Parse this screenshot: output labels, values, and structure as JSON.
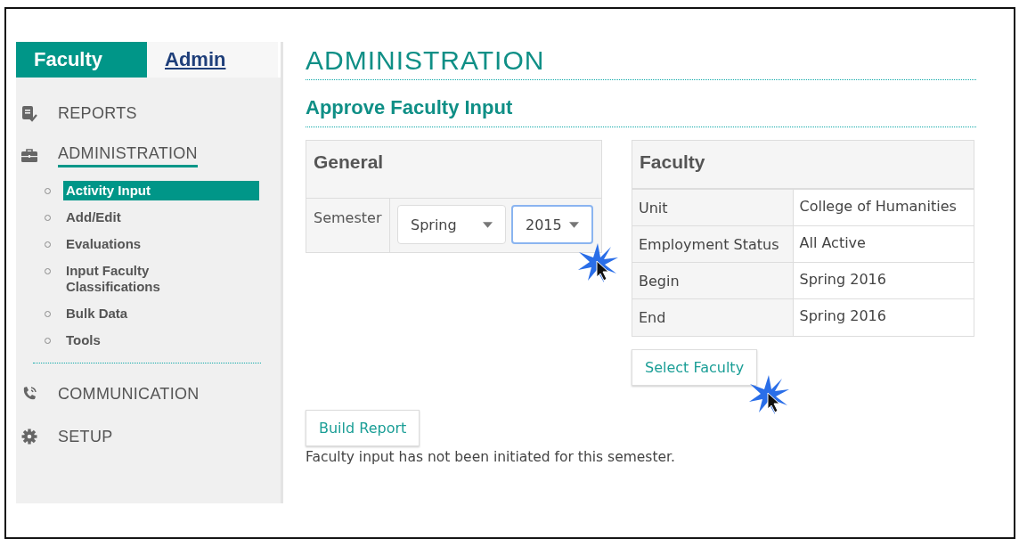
{
  "tabs": [
    {
      "label": "Faculty",
      "selected": true
    },
    {
      "label": "Admin",
      "selected": false
    }
  ],
  "nav": [
    {
      "label": "REPORTS",
      "selected": false
    },
    {
      "label": "ADMINISTRATION",
      "selected": true,
      "children": [
        {
          "label": "Activity Input",
          "selected": true
        },
        {
          "label": "Add/Edit",
          "selected": false
        },
        {
          "label": "Evaluations",
          "selected": false
        },
        {
          "label": "Input Faculty Classifications",
          "selected": false
        },
        {
          "label": "Bulk Data",
          "selected": false
        },
        {
          "label": "Tools",
          "selected": false
        }
      ]
    },
    {
      "label": "COMMUNICATION",
      "selected": false
    },
    {
      "label": "SETUP",
      "selected": false
    }
  ],
  "heading": "ADMINISTRATION",
  "subheading": "Approve Faculty Input",
  "general": {
    "title": "General",
    "field_label": "Semester",
    "selects": [
      {
        "value": "Spring",
        "focused": false
      },
      {
        "value": "2015",
        "focused": true
      }
    ]
  },
  "faculty": {
    "title": "Faculty",
    "rows": [
      {
        "label": "Unit",
        "value": "College of Humanities"
      },
      {
        "label": "Employment Status",
        "value": "All Active"
      },
      {
        "label": "Begin",
        "value": "Spring 2016"
      },
      {
        "label": "End",
        "value": "Spring 2016"
      }
    ],
    "button": "Select Faculty"
  },
  "build_button": "Build Report",
  "message": "Faculty input has not been initiated for this semester."
}
